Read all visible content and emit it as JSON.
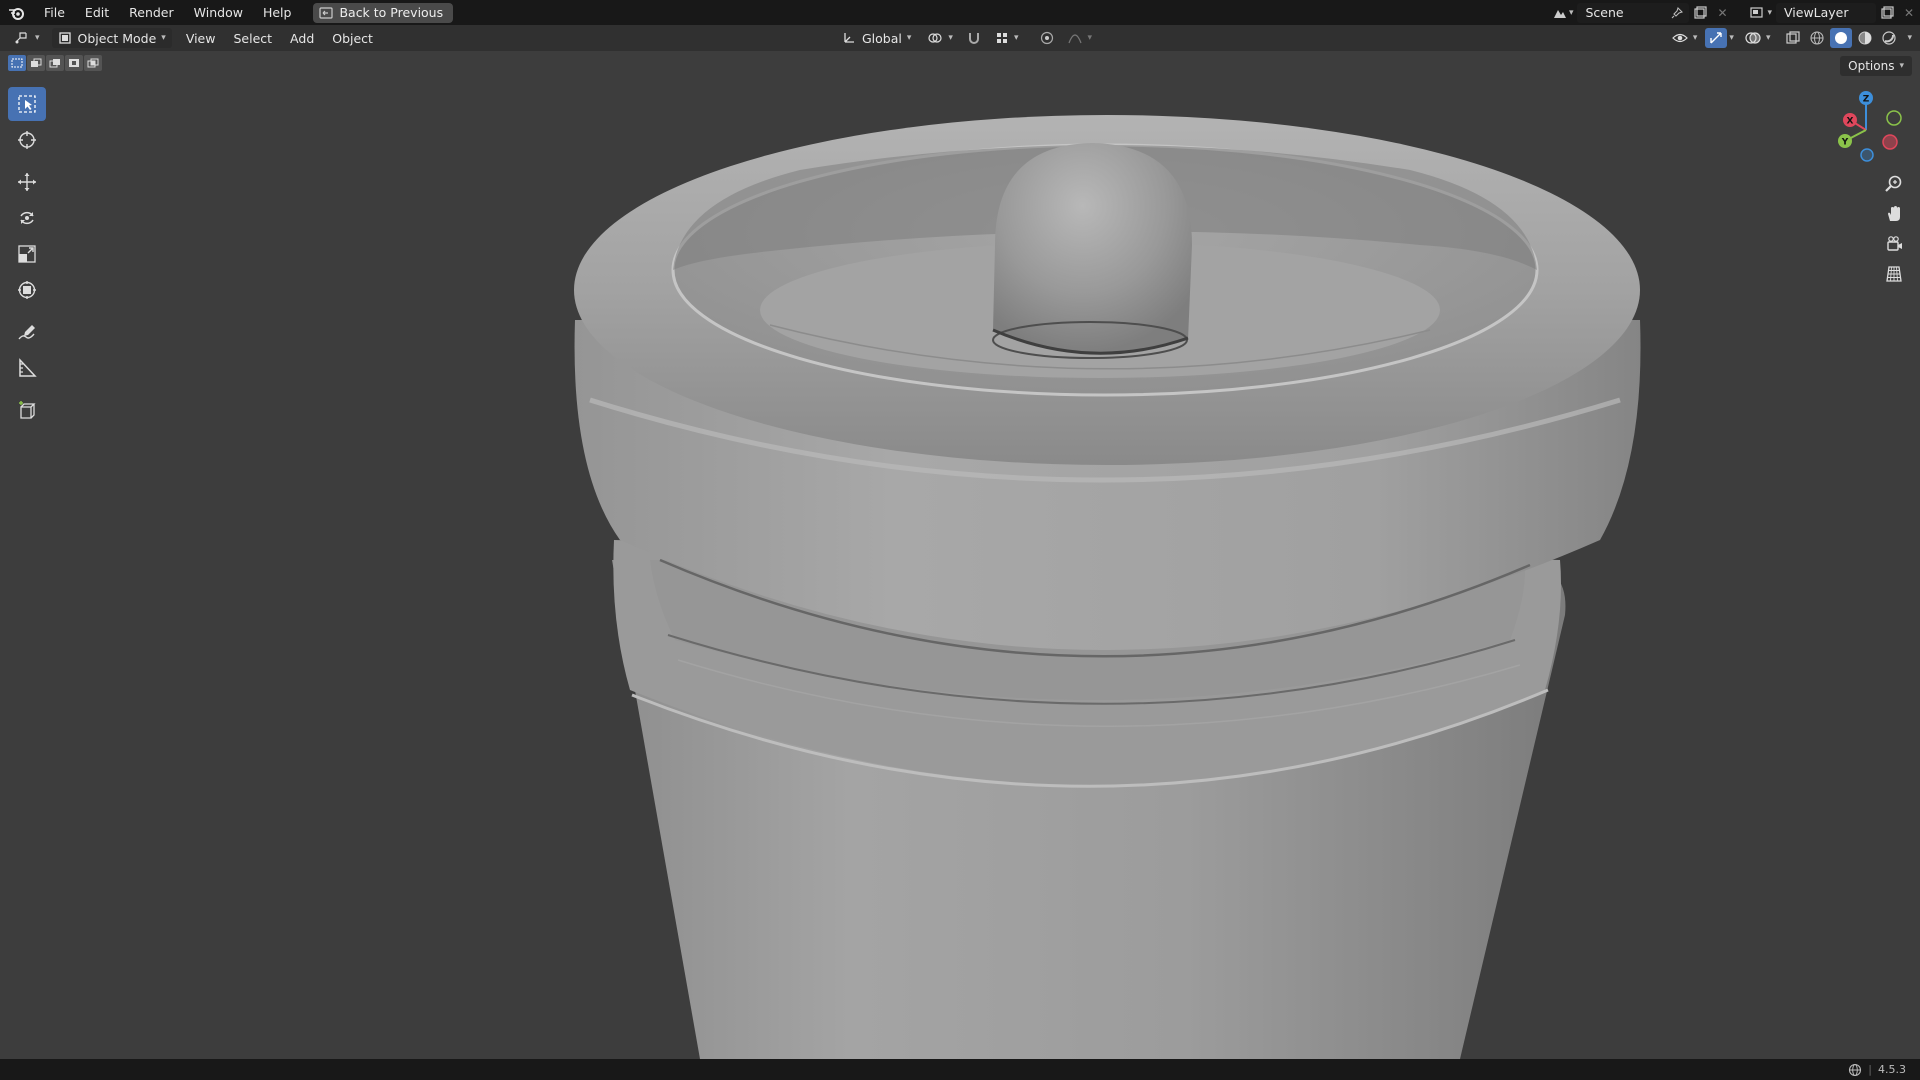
{
  "topbar": {
    "menus": [
      "File",
      "Edit",
      "Render",
      "Window",
      "Help"
    ],
    "back_button": "Back to Previous",
    "scene": "Scene",
    "view_layer": "ViewLayer"
  },
  "header": {
    "mode": "Object Mode",
    "menus": [
      "View",
      "Select",
      "Add",
      "Object"
    ],
    "transform_orientation": "Global"
  },
  "viewport": {
    "options_label": "Options",
    "gizmo_axes": [
      "X",
      "Y",
      "Z"
    ]
  },
  "toolbar": {
    "tools": [
      "select-box",
      "cursor",
      "move",
      "rotate",
      "scale",
      "transform",
      "annotate",
      "measure",
      "add-cube"
    ]
  },
  "status": {
    "version": "4.5.3"
  },
  "colors": {
    "accent": "#4772b3",
    "axis_x": "#e0475c",
    "axis_y": "#8bc34a",
    "axis_z": "#3d8fdb"
  }
}
